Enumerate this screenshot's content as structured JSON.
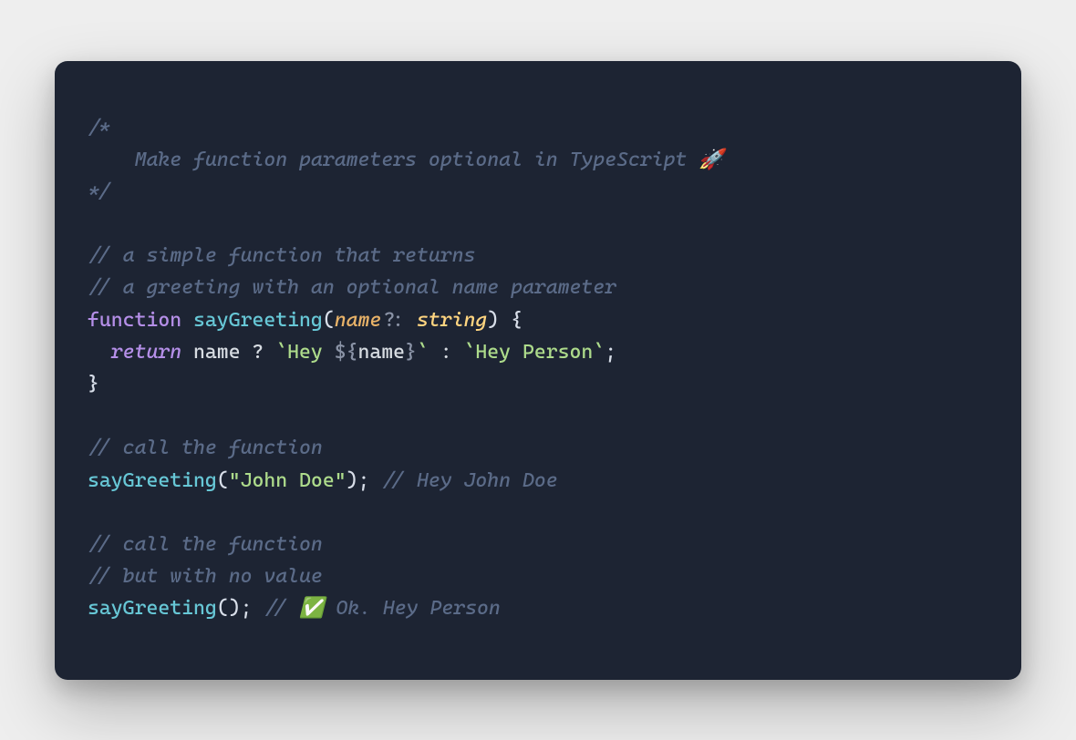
{
  "code": {
    "block_comment_open": "/*",
    "block_comment_line": "    Make function parameters optional in TypeScript 🚀",
    "block_comment_close": "*/",
    "c1": "// a simple function that returns",
    "c2": "// a greeting with an optional name parameter",
    "kw_function": "function",
    "fn_name": "sayGreeting",
    "paren_open": "(",
    "param_name": "name",
    "qmark": "?",
    "colon": ":",
    "type_string": "string",
    "paren_close": ")",
    "brace_open": "{",
    "kw_return": "return",
    "ident_name": "name",
    "ternary_q": "?",
    "tmpl_open1": "`Hey ",
    "interp_open": "${",
    "interp_ident": "name",
    "interp_close": "}",
    "tmpl_close1": "`",
    "ternary_colon": ":",
    "tmpl2": "`Hey Person`",
    "semicolon": ";",
    "brace_close": "}",
    "c3": "// call the function",
    "call1_name": "sayGreeting",
    "call1_arg": "\"John Doe\"",
    "call1_trailing": "// Hey John Doe",
    "c4": "// call the function",
    "c5": "// but with no value",
    "call2_name": "sayGreeting",
    "call2_trailing": "// ✅ Ok. Hey Person"
  },
  "colors": {
    "page_bg": "#eeeeee",
    "card_bg": "#1d2433",
    "comment": "#5b6b88",
    "keyword": "#b58fe8",
    "function": "#67c7d6",
    "param": "#e8b268",
    "type": "#ffd580",
    "string": "#addb8b",
    "default": "#d7dce2"
  }
}
